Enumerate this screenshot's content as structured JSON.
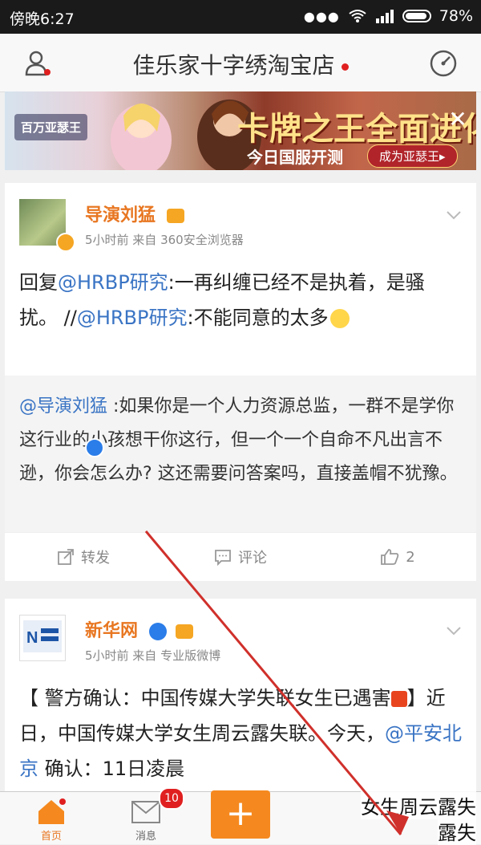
{
  "status": {
    "time": "傍晚6:27",
    "battery": "78%"
  },
  "header": {
    "title": "佳乐家十字绣淘宝店"
  },
  "banner": {
    "logo": "百万亚瑟王",
    "slogan": "卡牌之王全面进化",
    "sub": "今日国服开测",
    "cta": "成为亚瑟王▸"
  },
  "posts": [
    {
      "name": "导演刘猛",
      "meta": "5小时前  来自 360安全浏览器",
      "body": {
        "p1": "回复",
        "link1": "@HRBP研究",
        "p2": ":一再纠缠已经不是执着，是骚扰。 //",
        "link2": "@HRBP研究",
        "p3": ":不能同意的太多"
      },
      "repost": {
        "mention": "@导演刘猛",
        "text": " :如果你是一个人力资源总监，一群不是学你这行业的小孩想干你这行，但一个一个自命不凡出言不逊，你会怎么办? 这还需要问答案吗，直接盖帽不犹豫。"
      },
      "actions": {
        "repost": "转发",
        "comment": "评论",
        "like": "2"
      }
    },
    {
      "name": "新华网",
      "meta": "5小时前  来自 专业版微博",
      "body": {
        "p1": "【 警方确认：中国传媒大学失联女生已遇害",
        "p2": "】近日，中国传媒大学女生周云露失联。今天，",
        "link1": "@平安北京",
        "p3": " 确认：11日凌晨"
      }
    }
  ],
  "tabbar": {
    "home": "首页",
    "messages": "消息",
    "messages_badge": "10"
  },
  "overlay": {
    "line1": "女生周云露失",
    "line2": "露失"
  }
}
